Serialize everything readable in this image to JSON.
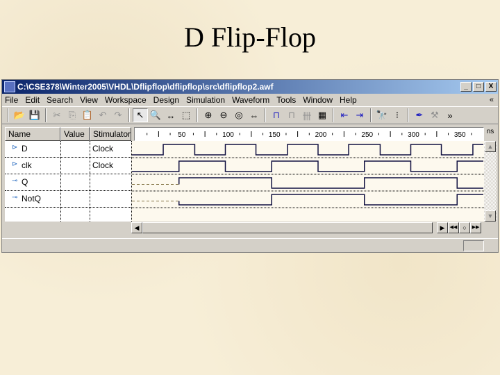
{
  "slide": {
    "title": "D Flip-Flop"
  },
  "window": {
    "title": "C:\\CSE378\\Winter2005\\VHDL\\Dflipflop\\dflipflop\\src\\dflipflop2.awf",
    "controls": {
      "minimize": "_",
      "maximize": "□",
      "close": "X"
    }
  },
  "menu": {
    "items": [
      "File",
      "Edit",
      "Search",
      "View",
      "Workspace",
      "Design",
      "Simulation",
      "Waveform",
      "Tools",
      "Window",
      "Help"
    ],
    "overflow": "«"
  },
  "toolbar": {
    "icons": [
      {
        "name": "open-folder-icon",
        "glyph": "📂"
      },
      {
        "name": "save-icon",
        "glyph": "💾"
      },
      {
        "sep": true
      },
      {
        "name": "cut-icon",
        "glyph": "✂",
        "dis": true
      },
      {
        "name": "copy-icon",
        "glyph": "⎘",
        "dis": true
      },
      {
        "name": "paste-icon",
        "glyph": "📋",
        "dis": true
      },
      {
        "name": "undo-icon",
        "glyph": "↶",
        "dis": true
      },
      {
        "name": "redo-icon",
        "glyph": "↷",
        "dis": true
      },
      {
        "sep": true
      },
      {
        "name": "pointer-icon",
        "glyph": "↖",
        "active": true
      },
      {
        "name": "zoom-icon",
        "glyph": "🔍"
      },
      {
        "name": "measure-icon",
        "glyph": "↔"
      },
      {
        "name": "select-bus-icon",
        "glyph": "⬚"
      },
      {
        "sep": true
      },
      {
        "name": "zoom-in-icon",
        "glyph": "⊕"
      },
      {
        "name": "zoom-out-icon",
        "glyph": "⊖"
      },
      {
        "name": "zoom-area-icon",
        "glyph": "◎"
      },
      {
        "name": "zoom-fit-icon",
        "glyph": "⇔"
      },
      {
        "sep": true
      },
      {
        "name": "add-signal-icon",
        "glyph": "⊓",
        "blue": true
      },
      {
        "name": "remove-signal-icon",
        "glyph": "⊓",
        "dis": true
      },
      {
        "name": "bus-icon",
        "glyph": "卌",
        "dis": true
      },
      {
        "name": "hierarchy-icon",
        "glyph": "▦"
      },
      {
        "sep": true
      },
      {
        "name": "prev-edge-icon",
        "glyph": "⇤",
        "blue": true
      },
      {
        "name": "next-edge-icon",
        "glyph": "⇥",
        "blue": true
      },
      {
        "sep": true
      },
      {
        "name": "find-icon",
        "glyph": "🔭"
      },
      {
        "name": "footsteps-icon",
        "glyph": "⁝"
      },
      {
        "sep": true
      },
      {
        "name": "ink-icon",
        "glyph": "✒",
        "blue": true
      },
      {
        "name": "tools-disabled-icon",
        "glyph": "⚒",
        "dis": true
      },
      {
        "name": "overflow-icon",
        "glyph": "»"
      }
    ]
  },
  "columns": {
    "name": "Name",
    "value": "Value",
    "stimulator": "Stimulator"
  },
  "signals": [
    {
      "name": "D",
      "value": "",
      "stimulator": "Clock",
      "dir": "in"
    },
    {
      "name": "clk",
      "value": "",
      "stimulator": "Clock",
      "dir": "in"
    },
    {
      "name": "Q",
      "value": "",
      "stimulator": "",
      "dir": "out"
    },
    {
      "name": "NotQ",
      "value": "",
      "stimulator": "",
      "dir": "out"
    }
  ],
  "ruler": {
    "unit": "ns",
    "labels": [
      "50",
      "100",
      "150",
      "200",
      "250",
      "300",
      "350"
    ],
    "range_ns": [
      0,
      375
    ]
  },
  "waveforms": {
    "D": {
      "initial": 0,
      "edges_ns": [
        33,
        67,
        100,
        133,
        167,
        200,
        233,
        267,
        300,
        333,
        367
      ]
    },
    "clk": {
      "initial": 0,
      "edges_ns": [
        50,
        100,
        150,
        200,
        250,
        300,
        350
      ]
    },
    "Q": {
      "initial": "U",
      "edges_ns": [
        50,
        150,
        250,
        350
      ],
      "values_after": [
        1,
        0,
        1,
        0
      ]
    },
    "NotQ": {
      "initial": "U",
      "edges_ns": [
        50,
        150,
        250,
        350
      ],
      "values_after": [
        0,
        1,
        0,
        1
      ]
    }
  },
  "nav": {
    "play": "▶",
    "rewind": "◀◀",
    "stop": "○",
    "ffwd": "▶▶"
  }
}
